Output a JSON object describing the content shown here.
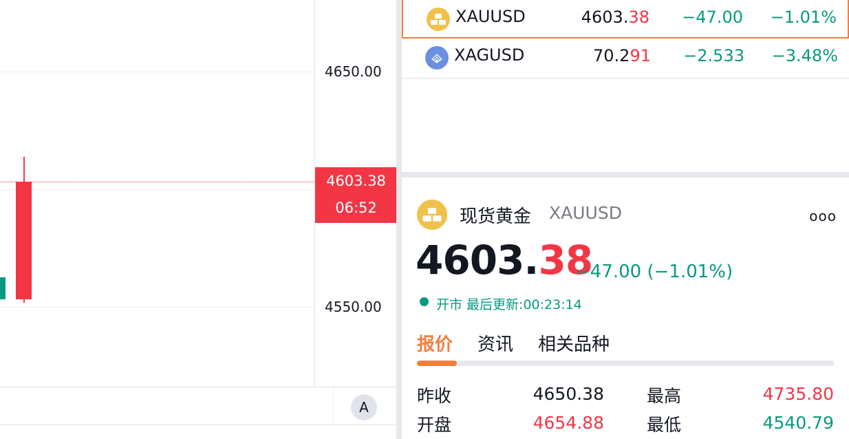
{
  "chart": {
    "axis_labels": [
      "4650.00",
      "4550.00"
    ],
    "last_price": "4603.38",
    "countdown": "06:52",
    "auto_scale_label": "A",
    "colors": {
      "up": "#089981",
      "down": "#f23645"
    }
  },
  "watchlist": {
    "rows": [
      {
        "symbol": "XAUUSD",
        "price_main": "4603.",
        "price_tail": "38",
        "change": "−47.00",
        "change_pct": "−1.01%",
        "icon": "gold-bar-icon",
        "selected": true
      },
      {
        "symbol": "XAGUSD",
        "price_main": "70.2",
        "price_tail": "91",
        "change": "−2.533",
        "change_pct": "−3.48%",
        "icon": "silver-bar-icon",
        "selected": false
      }
    ]
  },
  "detail": {
    "name": "现货黄金",
    "symbol": "XAUUSD",
    "more_label": "ooo",
    "price_main": "4603.",
    "price_tail": "38",
    "change": "−47.00 (−1.01%)",
    "status": "开市 最后更新:00:23:14",
    "tabs": [
      "报价",
      "资讯",
      "相关品种"
    ],
    "active_tab": "报价",
    "stats": [
      {
        "label": "昨收",
        "value": "4650.38",
        "color": "#131722"
      },
      {
        "label": "最高",
        "value": "4735.80",
        "color": "#f23645"
      },
      {
        "label": "开盘",
        "value": "4654.88",
        "color": "#f23645"
      },
      {
        "label": "最低",
        "value": "4540.79",
        "color": "#089981"
      }
    ]
  },
  "colors": {
    "accent": "#f47e3c",
    "up": "#089981",
    "down": "#f23645",
    "gold": "#f0c14b",
    "silver": "#6a8fe0"
  }
}
